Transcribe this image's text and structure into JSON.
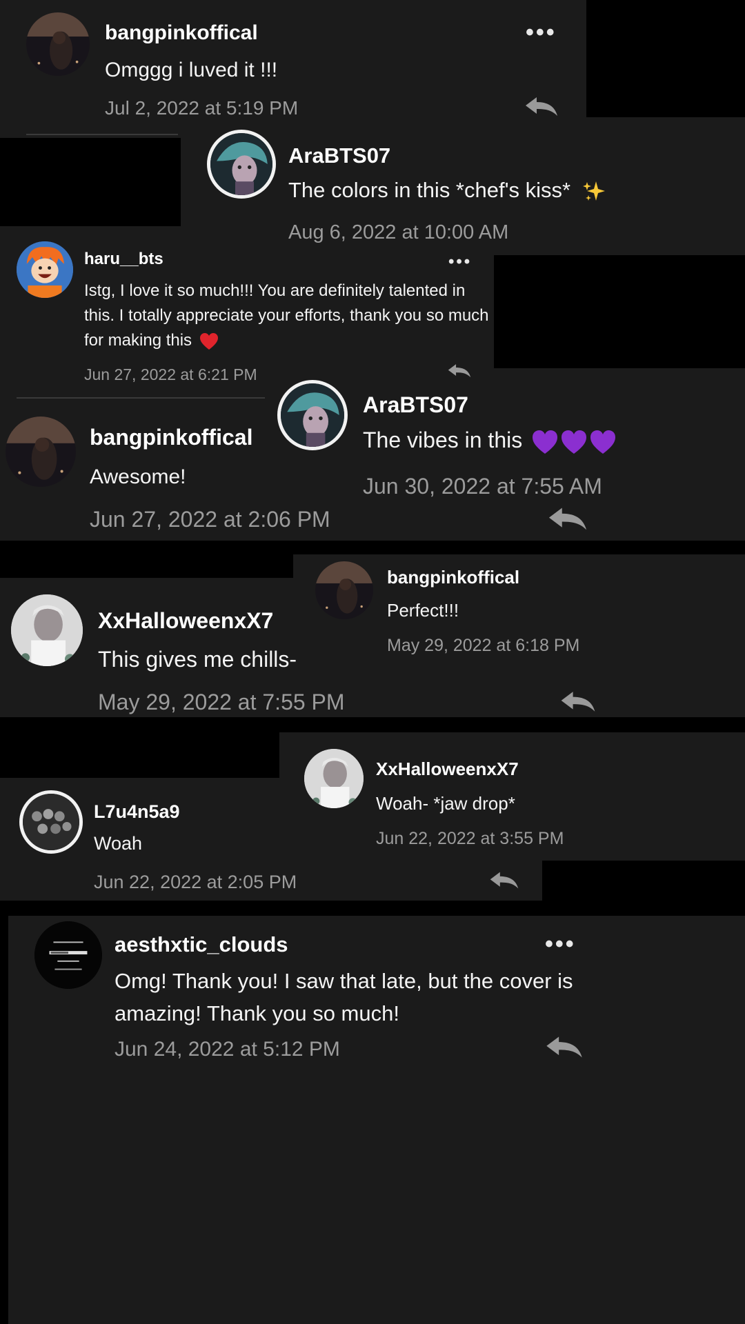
{
  "comments": [
    {
      "id": "c1",
      "username": "bangpinkoffical",
      "text": "Omggg i luved it !!!",
      "timestamp": "Jul 2, 2022 at 5:19 PM",
      "avatar": "dark-night-girl"
    },
    {
      "id": "c2",
      "username": "AraBTS07",
      "text": "The colors in this *chef's kiss*",
      "emoji": "sparkles",
      "timestamp": "Aug 6, 2022 at 10:00 AM",
      "avatar": "teal-portrait"
    },
    {
      "id": "c3",
      "username": "haru__bts",
      "text": "Istg, I love it so much!!! You are definitely talented in this. I totally appreciate your efforts, thank you so much for making this",
      "emoji": "red-heart",
      "timestamp": "Jun 27, 2022 at 6:21 PM",
      "avatar": "orange-anime-boy"
    },
    {
      "id": "c4",
      "username": "AraBTS07",
      "text": "The vibes in this",
      "emoji": "purple-hearts-x3",
      "timestamp": "Jun 30, 2022 at 7:55 AM",
      "avatar": "teal-portrait"
    },
    {
      "id": "c5",
      "username": "bangpinkoffical",
      "text": "Awesome!",
      "timestamp": "Jun 27, 2022 at 2:06 PM",
      "avatar": "dark-night-girl"
    },
    {
      "id": "c6",
      "username": "bangpinkoffical",
      "text": "Perfect!!!",
      "timestamp": "May 29, 2022 at 6:18 PM",
      "avatar": "dark-night-girl"
    },
    {
      "id": "c7",
      "username": "XxHalloweenxX7",
      "text": "This gives me chills-",
      "timestamp": "May 29, 2022 at 7:55 PM",
      "avatar": "pale-portrait"
    },
    {
      "id": "c8",
      "username": "XxHalloweenxX7",
      "text": "Woah- *jaw drop*",
      "timestamp": "Jun 22, 2022 at 3:55 PM",
      "avatar": "pale-portrait"
    },
    {
      "id": "c9",
      "username": "L7u4n5a9",
      "text": "Woah",
      "timestamp": "Jun 22, 2022 at 2:05 PM",
      "avatar": "group-photo"
    },
    {
      "id": "c10",
      "username": "aesthxtic_clouds",
      "text": "Omg! Thank you! I saw that late, but the cover is amazing! Thank you so much!",
      "timestamp": "Jun 24, 2022 at 5:12 PM",
      "avatar": "black-loading-screen"
    }
  ],
  "icons": {
    "more": "more-options-icon",
    "reply": "reply-icon"
  },
  "colors": {
    "background": "#1b1b1b",
    "cutout": "#000000",
    "timestamp": "#9c9c9c",
    "heart_red": "#e0242c",
    "heart_purple": "#8b2fd0"
  }
}
